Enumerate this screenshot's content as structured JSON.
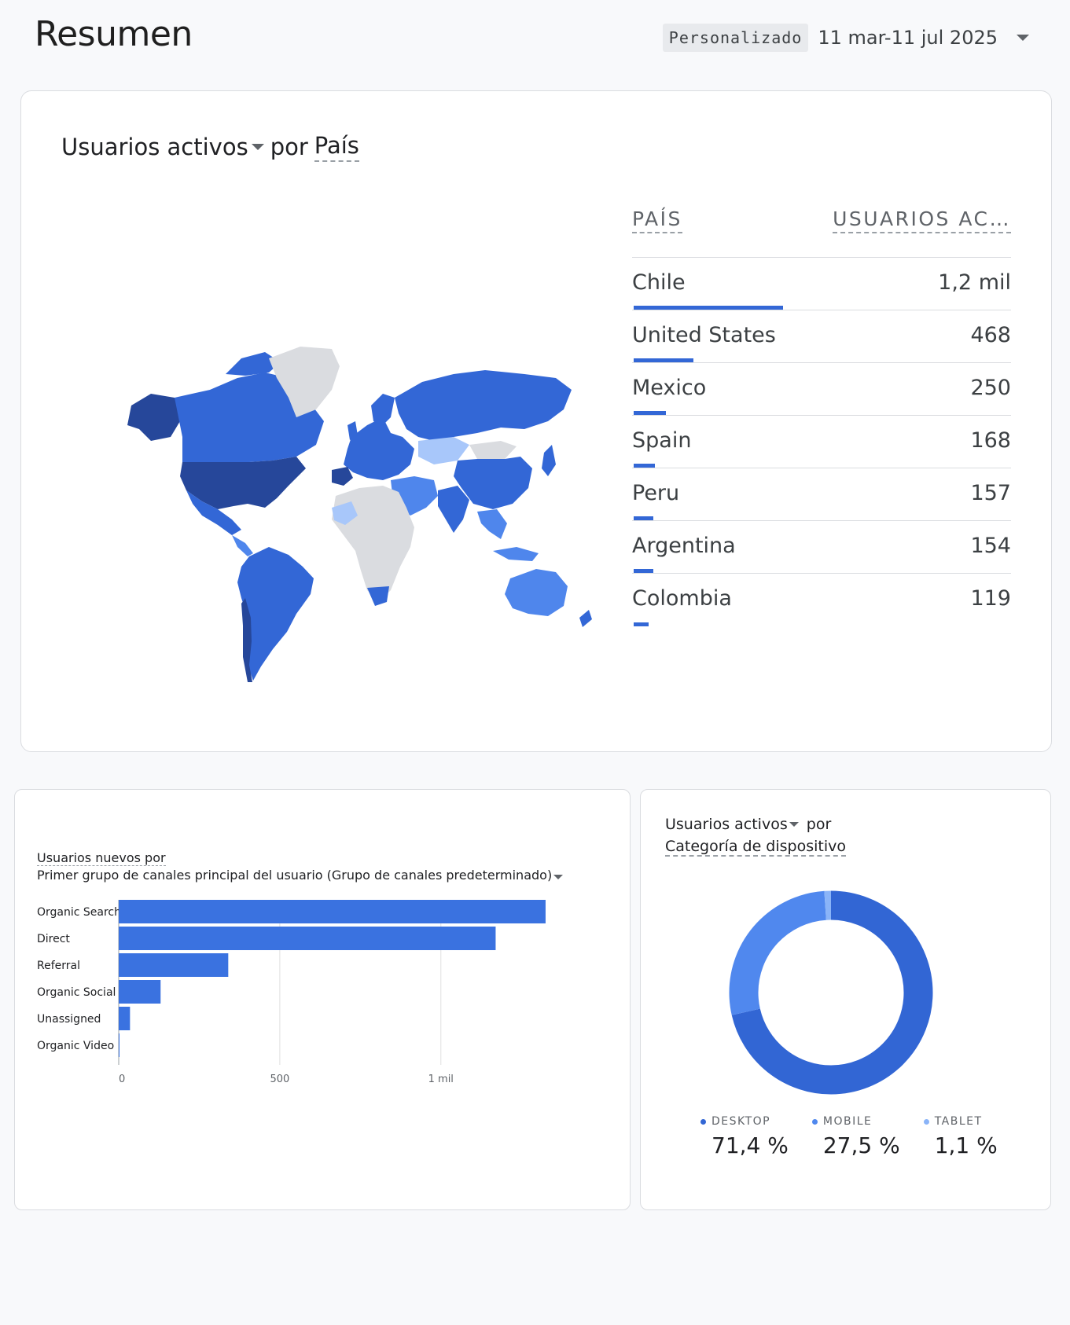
{
  "header": {
    "title": "Resumen",
    "range_chip": "Personalizado",
    "range_text": "11 mar-11 jul 2025"
  },
  "country_card": {
    "metric": "Usuarios activos",
    "by": "por",
    "dimension": "País",
    "table": {
      "col_country": "PAÍS",
      "col_users": "USUARIOS AC…",
      "rows": [
        {
          "country": "Chile",
          "users": "1,2 mil",
          "share": 1.0
        },
        {
          "country": "United States",
          "users": "468",
          "share": 0.4
        },
        {
          "country": "Mexico",
          "users": "250",
          "share": 0.214
        },
        {
          "country": "Spain",
          "users": "168",
          "share": 0.144
        },
        {
          "country": "Peru",
          "users": "157",
          "share": 0.134
        },
        {
          "country": "Argentina",
          "users": "154",
          "share": 0.132
        },
        {
          "country": "Colombia",
          "users": "119",
          "share": 0.102
        }
      ]
    },
    "colors": {
      "dark": "#26479a",
      "mid": "#3367d6",
      "light": "#4f86ec",
      "pale": "#a8c7fa",
      "none": "#dadce0"
    }
  },
  "channels_card": {
    "line1": "Usuarios nuevos por",
    "line2": "Primer grupo de canales principal del usuario (Grupo de canales predeterminado)",
    "chart_data": {
      "type": "bar",
      "orientation": "horizontal",
      "categories": [
        "Organic Search",
        "Direct",
        "Referral",
        "Organic Social",
        "Unassigned",
        "Organic Video"
      ],
      "values": [
        1325,
        1170,
        340,
        130,
        35,
        2
      ],
      "xlim": [
        0,
        1330
      ],
      "xticks": [
        {
          "v": 0,
          "label": "0"
        },
        {
          "v": 500,
          "label": "500"
        },
        {
          "v": 1000,
          "label": "1 mil"
        }
      ],
      "color": "#3a72e0"
    }
  },
  "device_card": {
    "line1": "Usuarios activos",
    "by": "por",
    "line2": "Categoría de dispositivo",
    "chart_data": {
      "type": "pie",
      "style": "donut",
      "slices": [
        {
          "label": "DESKTOP",
          "value": 71.4,
          "display": "71,4 %",
          "color": "#3266d4"
        },
        {
          "label": "MOBILE",
          "value": 27.5,
          "display": "27,5 %",
          "color": "#5088ee"
        },
        {
          "label": "TABLET",
          "value": 1.1,
          "display": "1,1 %",
          "color": "#8ab4f8"
        }
      ]
    }
  }
}
